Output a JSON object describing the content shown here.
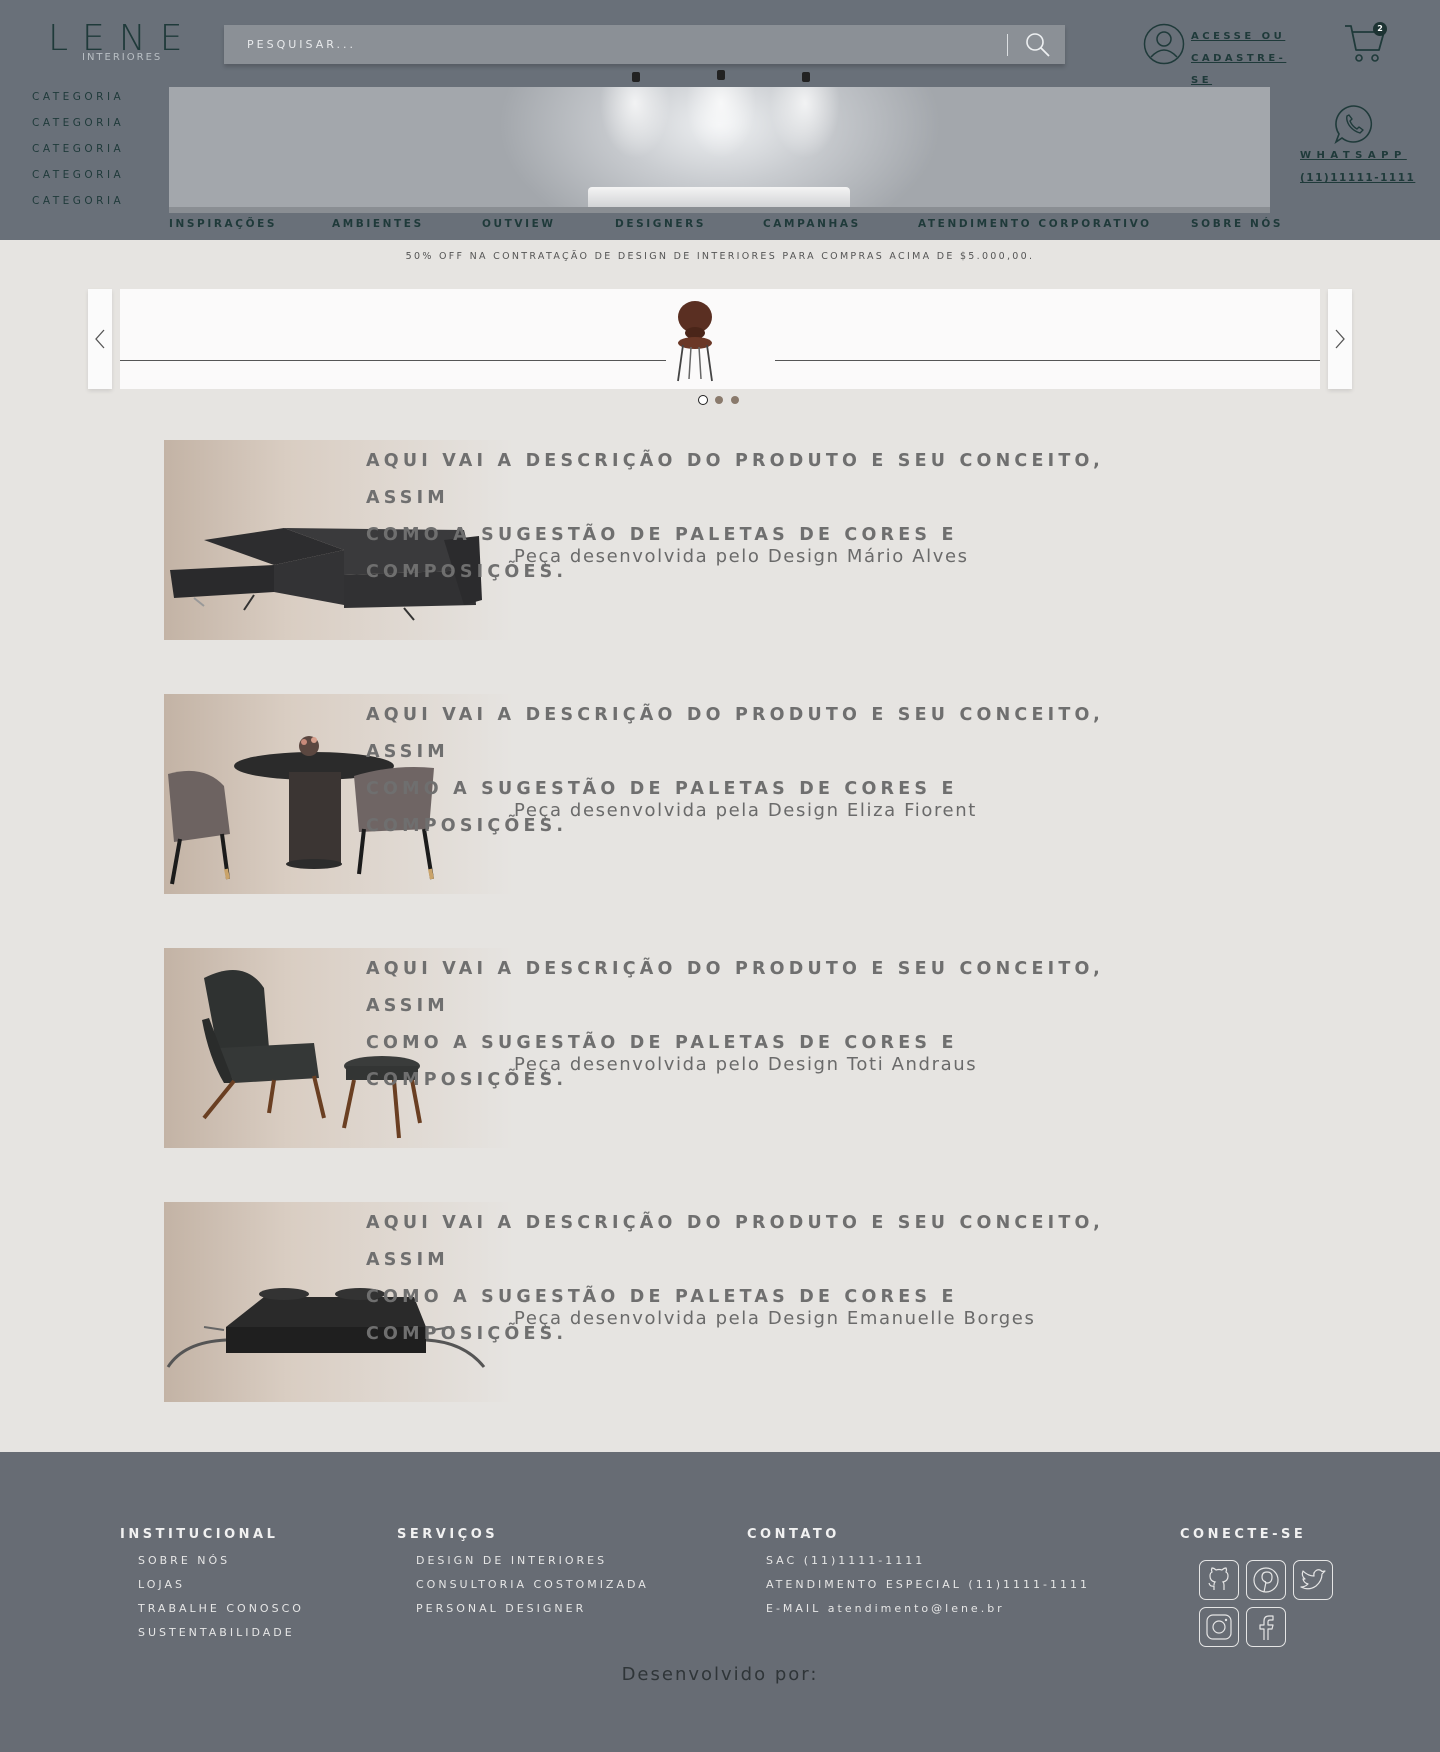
{
  "brand": {
    "name": "LENE",
    "tagline": "INTERIORES"
  },
  "search": {
    "placeholder": "PESQUISAR..."
  },
  "account": {
    "line1": "ACESSE OU",
    "line2": "CADASTRE-SE"
  },
  "cart": {
    "count": "2"
  },
  "categories": [
    "CATEGORIA",
    "CATEGORIA",
    "CATEGORIA",
    "CATEGORIA",
    "CATEGORIA"
  ],
  "whatsapp": {
    "label": "WHATSAPP",
    "phone": "(11)11111-1111"
  },
  "nav": [
    "INSPIRAÇÕES",
    "AMBIENTES",
    "OUTVIEW",
    "DESIGNERS",
    "CAMPANHAS",
    "ATENDIMENTO CORPORATIVO",
    "SOBRE NÓS"
  ],
  "promo": "50% OFF NA CONTRATAÇÃO DE DESIGN DE INTERIORES PARA COMPRAS ACIMA DE $5.000,00.",
  "carousel": {
    "active_slide": 1,
    "total_slides": 3
  },
  "products": [
    {
      "line1": "AQUI VAI A DESCRIÇÃO DO PRODUTO E SEU CONCEITO, ASSIM",
      "line2": "COMO A SUGESTÃO DE PALETAS DE CORES E COMPOSIÇÕES.",
      "designer": "Peça desenvolvida pelo Design Mário Alves",
      "image": "sofa"
    },
    {
      "line1": "AQUI VAI A DESCRIÇÃO DO PRODUTO E SEU CONCEITO, ASSIM",
      "line2": "COMO A SUGESTÃO DE PALETAS DE CORES E COMPOSIÇÕES.",
      "designer": "Peça desenvolvida pela Design Eliza Fiorent",
      "image": "dining-table"
    },
    {
      "line1": "AQUI VAI A DESCRIÇÃO DO PRODUTO E SEU CONCEITO, ASSIM",
      "line2": "COMO A SUGESTÃO DE PALETAS DE CORES E COMPOSIÇÕES.",
      "designer": "Peça desenvolvida pelo Design Toti Andraus",
      "image": "armchair"
    },
    {
      "line1": "AQUI VAI A DESCRIÇÃO DO PRODUTO E SEU CONCEITO, ASSIM",
      "line2": "COMO A SUGESTÃO DE PALETAS DE CORES E COMPOSIÇÕES.",
      "designer": "Peça desenvolvida pela Design Emanuelle Borges",
      "image": "bed"
    }
  ],
  "footer": {
    "institucional": {
      "title": "INSTITUCIONAL",
      "links": [
        "SOBRE NÓS",
        "LOJAS",
        "TRABALHE CONOSCO",
        "SUSTENTABILIDADE"
      ]
    },
    "servicos": {
      "title": "SERVIÇOS",
      "links": [
        "DESIGN DE INTERIORES",
        "CONSULTORIA COSTOMIZADA",
        "PERSONAL DESIGNER"
      ]
    },
    "contato": {
      "title": "CONTATO",
      "links": [
        "SAC (11)1111-1111",
        "ATENDIMENTO ESPECIAL (11)1111-1111",
        "E-MAIL atendimento@lene.br"
      ]
    },
    "social": {
      "title": "CONECTE-SE",
      "icons": [
        "github-icon",
        "pinterest-icon",
        "twitter-icon",
        "instagram-icon",
        "facebook-icon"
      ]
    },
    "developed_by": "Desenvolvido por:"
  },
  "colors": {
    "header_bg": "#697079",
    "page_bg": "#e6e4e1",
    "footer_bg": "#676c74",
    "brand_dark": "#1f3a3a"
  }
}
